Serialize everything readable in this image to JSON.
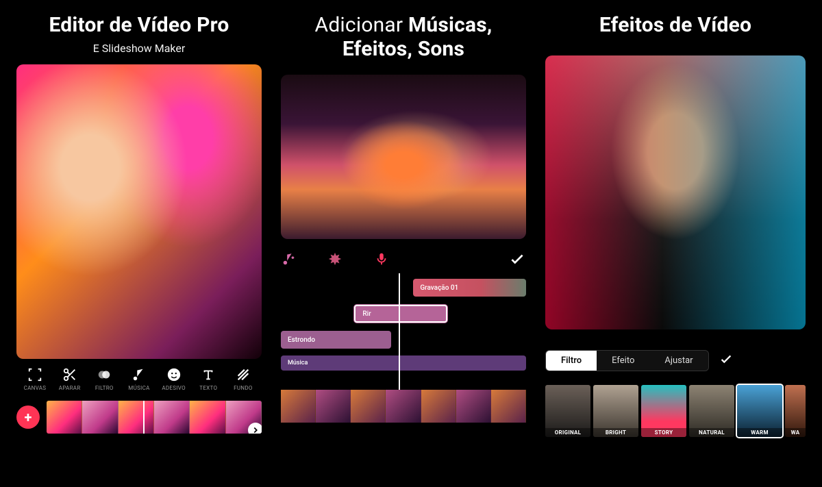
{
  "panel1": {
    "title": "Editor de Vídeo Pro",
    "subtitle": "E Slideshow Maker",
    "tools": [
      {
        "id": "canvas",
        "label": "CANVAS"
      },
      {
        "id": "aparar",
        "label": "APARAR"
      },
      {
        "id": "filtro",
        "label": "FILTRO"
      },
      {
        "id": "musica",
        "label": "MÚSICA"
      },
      {
        "id": "adesivo",
        "label": "ADESIVO"
      },
      {
        "id": "texto",
        "label": "TEXTO"
      },
      {
        "id": "fundo",
        "label": "FUNDO"
      }
    ],
    "add_glyph": "+"
  },
  "panel2": {
    "title_light": "Adicionar ",
    "title_bold": "Músicas, Efeitos, Sons",
    "tracks": {
      "recording": "Gravação 01",
      "rir": "Rir",
      "estrondo": "Estrondo",
      "musica": "Música"
    }
  },
  "panel3": {
    "title": "Efeitos de Vídeo",
    "tabs": {
      "filtro": "Filtro",
      "efeito": "Efeito",
      "ajustar": "Ajustar"
    },
    "presets": [
      {
        "id": "original",
        "label": "ORIGINAL"
      },
      {
        "id": "bright",
        "label": "BRIGHT"
      },
      {
        "id": "story",
        "label": "STORY"
      },
      {
        "id": "natural",
        "label": "NATURAL"
      },
      {
        "id": "warm",
        "label": "WARM"
      },
      {
        "id": "wa",
        "label": "WA"
      }
    ]
  }
}
